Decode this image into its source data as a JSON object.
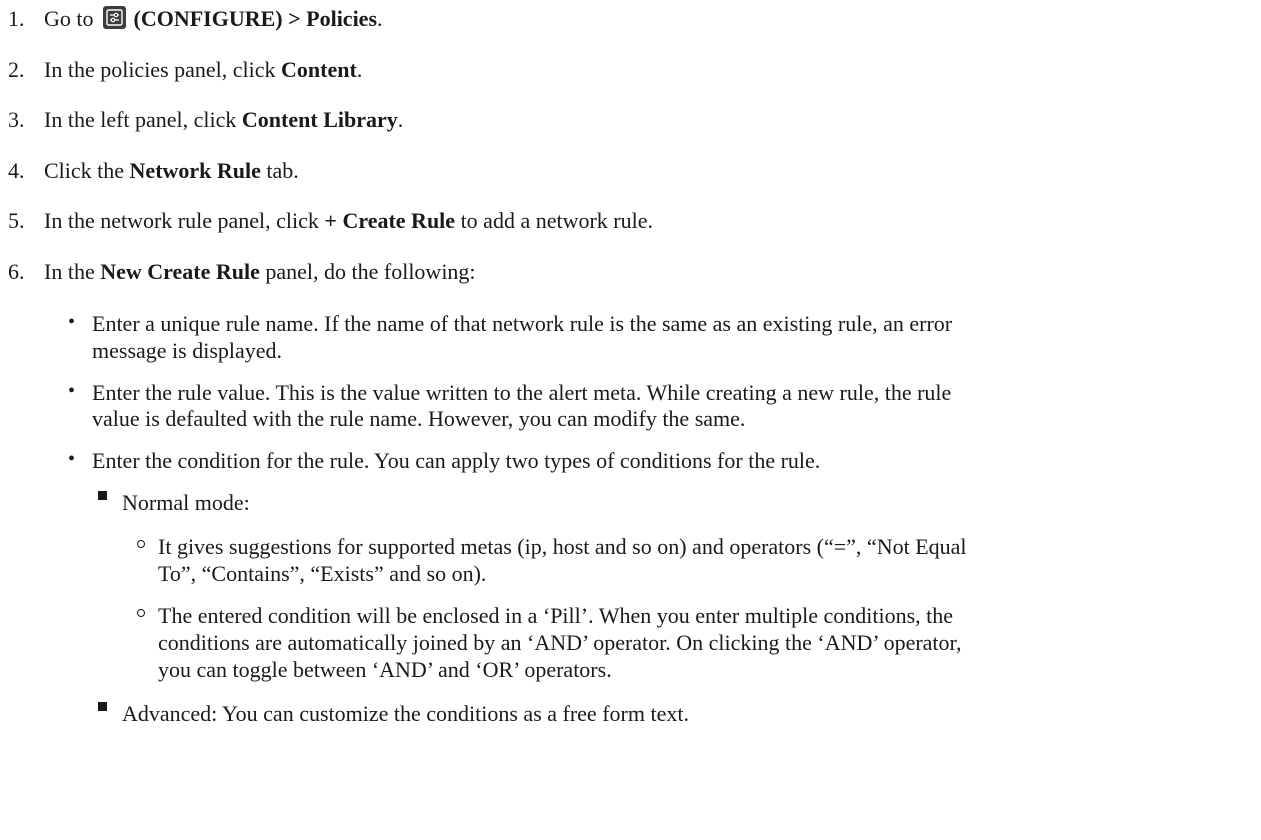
{
  "steps": [
    {
      "number": "1.",
      "prefix": "Go to",
      "bold": "(CONFIGURE) > Policies",
      "suffix": ".",
      "icon": "configure-icon"
    },
    {
      "number": "2.",
      "prefix": "In the policies panel, click",
      "bold": "Content",
      "suffix": "."
    },
    {
      "number": "3.",
      "prefix": "In the left panel, click",
      "bold": "Content Library",
      "suffix": "."
    },
    {
      "number": "4.",
      "prefix": "Click the",
      "bold": "Network Rule",
      "suffix": "tab."
    },
    {
      "number": "5.",
      "prefix": "In the network rule panel, click",
      "bold": "+ Create Rule",
      "suffix": "to add a network rule."
    },
    {
      "number": "6.",
      "prefix": "In the",
      "bold": "New Create Rule",
      "suffix": "panel, do the following:"
    }
  ],
  "bullets": {
    "rule_name": {
      "line1": "Enter a unique rule name. If the name of that network rule is the same as an existing rule, an error",
      "line2": "message is displayed."
    },
    "rule_value": {
      "line1": "Enter the rule value. This is the value written to the alert meta. While creating a new rule, the rule",
      "line2": "value is defaulted with the rule name. However, you can modify the same."
    },
    "condition": {
      "line1": "Enter the condition for the rule. You can apply two types of conditions for the rule."
    }
  },
  "modes": {
    "normal": {
      "label": "Normal mode:",
      "items": [
        {
          "line1": "It gives suggestions for supported metas (ip, host and so on) and operators (“=”, “Not Equal",
          "line2": "To”, “Contains”, “Exists” and so on)."
        },
        {
          "line1": "The entered condition will be enclosed in a ‘Pill’. When you enter multiple conditions, the",
          "line2": "conditions are automatically joined by an ‘AND’ operator. On clicking the ‘AND’ operator,",
          "line3": "you can toggle between ‘AND’ and ‘OR’ operators."
        }
      ]
    },
    "advanced": {
      "label": "Advanced: You can customize the conditions as a free form text."
    }
  }
}
